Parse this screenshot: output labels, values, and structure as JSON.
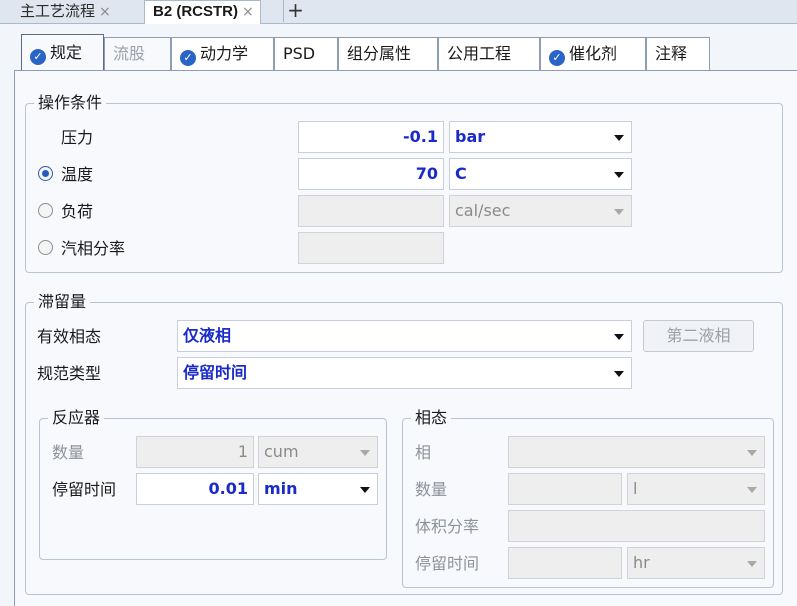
{
  "doc_tabs": [
    {
      "label": "主工艺流程",
      "close": "×"
    },
    {
      "label": "B2 (RCSTR)",
      "close": "×"
    }
  ],
  "new_tab": "+",
  "form_tabs": [
    {
      "label": "规定"
    },
    {
      "label": "流股"
    },
    {
      "label": "动力学"
    },
    {
      "label": "PSD"
    },
    {
      "label": "组分属性"
    },
    {
      "label": "公用工程"
    },
    {
      "label": "催化剂"
    },
    {
      "label": "注释"
    }
  ],
  "operating_conditions": {
    "title": "操作条件",
    "pressure": {
      "label": "压力",
      "value": "-0.1",
      "unit": "bar"
    },
    "temperature": {
      "label": "温度",
      "value": "70",
      "unit": "C"
    },
    "duty": {
      "label": "负荷",
      "value": "",
      "unit": "cal/sec"
    },
    "vapor_fraction": {
      "label": "汽相分率",
      "value": ""
    }
  },
  "holdup": {
    "title": "滞留量",
    "valid_phases": {
      "label": "有效相态",
      "value": "仅液相"
    },
    "second_liquid_button": "第二液相",
    "spec_type": {
      "label": "规范类型",
      "value": "停留时间"
    },
    "reactor": {
      "title": "反应器",
      "quantity": {
        "label": "数量",
        "value": "1",
        "unit": "cum"
      },
      "residence_time": {
        "label": "停留时间",
        "value": "0.01",
        "unit": "min"
      }
    },
    "phase": {
      "title": "相态",
      "phase": {
        "label": "相",
        "value": ""
      },
      "quantity": {
        "label": "数量",
        "value": "",
        "unit": "l"
      },
      "volume_fraction": {
        "label": "体积分率",
        "value": ""
      },
      "residence_time": {
        "label": "停留时间",
        "value": "",
        "unit": "hr"
      }
    }
  }
}
